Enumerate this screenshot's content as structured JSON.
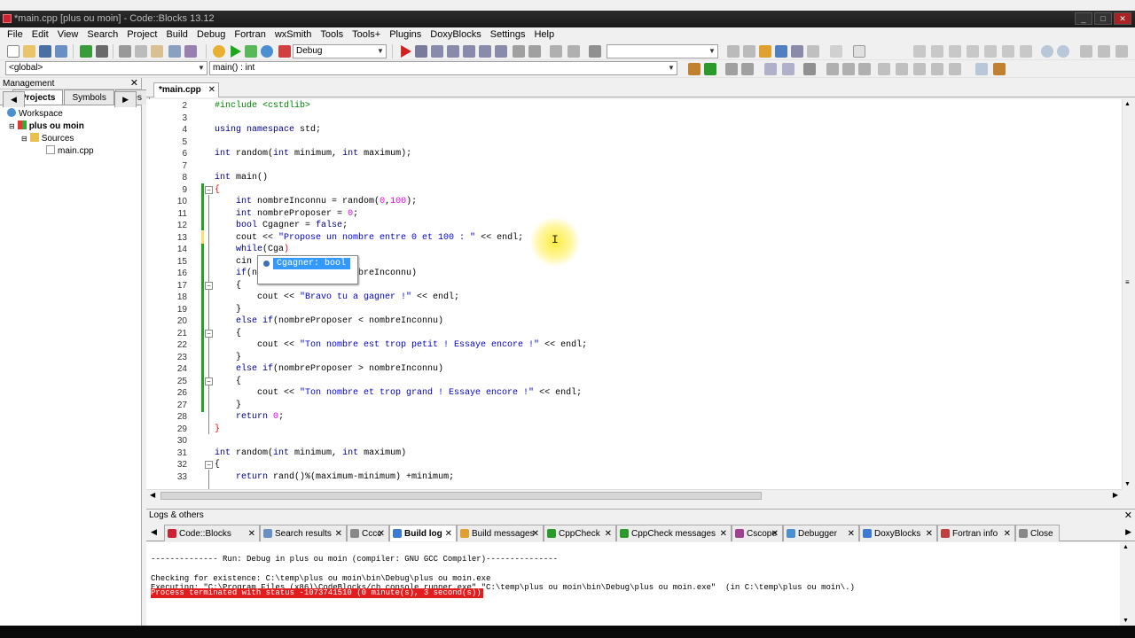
{
  "window": {
    "title": "*main.cpp [plus ou moin] - Code::Blocks 13.12"
  },
  "menu": [
    "File",
    "Edit",
    "View",
    "Search",
    "Project",
    "Build",
    "Debug",
    "Fortran",
    "wxSmith",
    "Tools",
    "Tools+",
    "Plugins",
    "DoxyBlocks",
    "Settings",
    "Help"
  ],
  "toolbar": {
    "build_target": "Debug",
    "scope": "<global>",
    "function": "main() : int"
  },
  "management": {
    "title": "Management",
    "tabs": [
      "Projects",
      "Symbols",
      "Files"
    ],
    "tree": {
      "workspace": "Workspace",
      "project": "plus ou moin",
      "folder": "Sources",
      "file": "main.cpp"
    }
  },
  "editor": {
    "tab": "*main.cpp",
    "autocomplete": "Cgagner: bool",
    "lines": [
      {
        "n": "2",
        "html": "<span class='pp'>#include &lt;cstdlib&gt;</span>"
      },
      {
        "n": "3",
        "html": ""
      },
      {
        "n": "4",
        "html": "<span class='kw'>using namespace</span> std;"
      },
      {
        "n": "5",
        "html": ""
      },
      {
        "n": "6",
        "html": "<span class='kw'>int</span> random(<span class='kw'>int</span> minimum, <span class='kw'>int</span> maximum);"
      },
      {
        "n": "7",
        "html": ""
      },
      {
        "n": "8",
        "html": "<span class='kw'>int</span> main()"
      },
      {
        "n": "9",
        "html": "<span class='op'>{</span>"
      },
      {
        "n": "10",
        "html": "    <span class='kw'>int</span> nombreInconnu = random(<span class='num'>0</span>,<span class='num'>100</span>);"
      },
      {
        "n": "11",
        "html": "    <span class='kw'>int</span> nombreProposer = <span class='num'>0</span>;"
      },
      {
        "n": "12",
        "html": "    <span class='kw'>bool</span> Cgagner = <span class='kw'>false</span>;"
      },
      {
        "n": "13",
        "html": "    cout &lt;&lt; <span class='str'>\"Propose un nombre entre 0 et 100 : \"</span> &lt;&lt; endl;"
      },
      {
        "n": "14",
        "html": "    <span class='kw'>while</span>(Cga<span class='op'>)</span>"
      },
      {
        "n": "15",
        "html": "    cin"
      },
      {
        "n": "16",
        "html": "    <span class='kw'>if</span>(n                  mbreInconnu)"
      },
      {
        "n": "17",
        "html": "    {"
      },
      {
        "n": "18",
        "html": "        cout &lt;&lt; <span class='str'>\"Bravo tu a gagner !\"</span> &lt;&lt; endl;"
      },
      {
        "n": "19",
        "html": "    }"
      },
      {
        "n": "20",
        "html": "    <span class='kw'>else if</span>(nombreProposer &lt; nombreInconnu)"
      },
      {
        "n": "21",
        "html": "    {"
      },
      {
        "n": "22",
        "html": "        cout &lt;&lt; <span class='str'>\"Ton nombre est trop petit ! Essaye encore !\"</span> &lt;&lt; endl;"
      },
      {
        "n": "23",
        "html": "    }"
      },
      {
        "n": "24",
        "html": "    <span class='kw'>else if</span>(nombreProposer &gt; nombreInconnu)"
      },
      {
        "n": "25",
        "html": "    {"
      },
      {
        "n": "26",
        "html": "        cout &lt;&lt; <span class='str'>\"Ton nombre et trop grand ! Essaye encore !\"</span> &lt;&lt; endl;"
      },
      {
        "n": "27",
        "html": "    }"
      },
      {
        "n": "28",
        "html": "    <span class='kw'>return</span> <span class='num'>0</span>;"
      },
      {
        "n": "29",
        "html": "<span class='op'>}</span>"
      },
      {
        "n": "30",
        "html": ""
      },
      {
        "n": "31",
        "html": "<span class='kw'>int</span> random(<span class='kw'>int</span> minimum, <span class='kw'>int</span> maximum)"
      },
      {
        "n": "32",
        "html": "{"
      },
      {
        "n": "33",
        "html": "    <span class='kw'>return</span> rand()%(maximum-minimum) +minimum;"
      }
    ]
  },
  "logs": {
    "title": "Logs & others",
    "tabs": [
      "Code::Blocks",
      "Search results",
      "Cccc",
      "Build log",
      "Build messages",
      "CppCheck",
      "CppCheck messages",
      "Cscope",
      "Debugger",
      "DoxyBlocks",
      "Fortran info",
      "Close"
    ],
    "lines": [
      "-------------- Run: Debug in plus ou moin (compiler: GNU GCC Compiler)---------------",
      "Checking for existence: C:\\temp\\plus ou moin\\bin\\Debug\\plus ou moin.exe",
      "Executing: \"C:\\Program Files (x86)\\CodeBlocks/cb_console_runner.exe\" \"C:\\temp\\plus ou moin\\bin\\Debug\\plus ou moin.exe\"  (in C:\\temp\\plus ou moin\\.)"
    ],
    "error": "Process terminated with status -1073741510 (0 minute(s), 3 second(s))"
  }
}
